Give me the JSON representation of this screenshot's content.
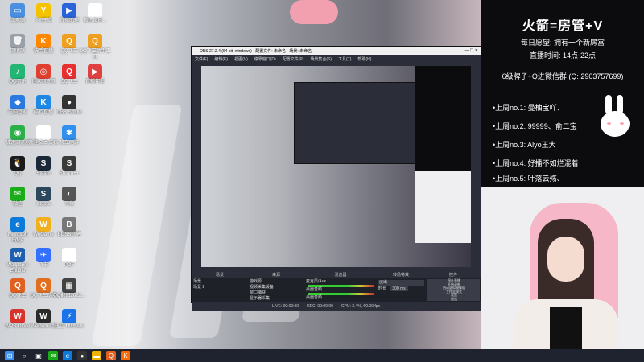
{
  "desktop": {
    "icons": [
      {
        "label": "此电脑",
        "color": "#4a8fe0",
        "glyph": "▭"
      },
      {
        "label": "YY开播",
        "color": "#f5c200",
        "glyph": "Y"
      },
      {
        "label": "直播助理",
        "color": "#2a64d8",
        "glyph": "▶"
      },
      {
        "label": "微信图片...",
        "color": "#ffffff",
        "glyph": "▦"
      },
      {
        "label": "回收站",
        "color": "#9aa0a8",
        "glyph": "🗑"
      },
      {
        "label": "快手直播",
        "color": "#ff8800",
        "glyph": "K"
      },
      {
        "label": "QQ飞车",
        "color": "#f0a020",
        "glyph": "Q"
      },
      {
        "label": "QQ飞车助手工具",
        "color": "#f0a020",
        "glyph": "Q"
      },
      {
        "label": "QQ音乐",
        "color": "#22b573",
        "glyph": "♪"
      },
      {
        "label": "谷歌浏览器",
        "color": "#e04030",
        "glyph": "◎"
      },
      {
        "label": "QQ飞车",
        "color": "#e83030",
        "glyph": "Q"
      },
      {
        "label": "直播伴侣",
        "color": "#e04040",
        "glyph": "▶"
      },
      {
        "label": "电脑管家",
        "color": "#2a7ae0",
        "glyph": "◆"
      },
      {
        "label": "酷狗直播",
        "color": "#1f88e5",
        "glyph": "K"
      },
      {
        "label": "OBS Studio",
        "color": "#333333",
        "glyph": "●"
      },
      {
        "label": "",
        "color": "#00000000",
        "glyph": ""
      },
      {
        "label": "极速浏览器",
        "color": "#2bb04a",
        "glyph": "◉"
      },
      {
        "label": "新建文本文档",
        "color": "#ffffff",
        "glyph": "▤"
      },
      {
        "label": "风车网游",
        "color": "#3090f0",
        "glyph": "✱"
      },
      {
        "label": "",
        "color": "#00000000",
        "glyph": ""
      },
      {
        "label": "QQ",
        "color": "#1a1a1a",
        "glyph": "🐧"
      },
      {
        "label": "Steam",
        "color": "#1b2838",
        "glyph": "S"
      },
      {
        "label": "Steam++",
        "color": "#3a3a3a",
        "glyph": "S"
      },
      {
        "label": "",
        "color": "#00000000",
        "glyph": ""
      },
      {
        "label": "微信",
        "color": "#1aad19",
        "glyph": "✉"
      },
      {
        "label": "Steam",
        "color": "#2a475e",
        "glyph": "S"
      },
      {
        "label": "斗鱼",
        "color": "#555555",
        "glyph": "◐"
      },
      {
        "label": "",
        "color": "#00000000",
        "glyph": ""
      },
      {
        "label": "Microsoft Edge",
        "color": "#0c7ad8",
        "glyph": "e"
      },
      {
        "label": "WeGame",
        "color": "#f0b020",
        "glyph": "W"
      },
      {
        "label": "BOSS直聘",
        "color": "#777777",
        "glyph": "B"
      },
      {
        "label": "",
        "color": "#00000000",
        "glyph": ""
      },
      {
        "label": "Wallpaper Engine",
        "color": "#1e5fb0",
        "glyph": "W"
      },
      {
        "label": "飞书",
        "color": "#3370ff",
        "glyph": "✈"
      },
      {
        "label": "PDF",
        "color": "#ffffff",
        "glyph": "P"
      },
      {
        "label": "",
        "color": "#00000000",
        "glyph": ""
      },
      {
        "label": "QQ飞车",
        "color": "#e06020",
        "glyph": "Q"
      },
      {
        "label": "QQ飞车助手",
        "color": "#e07020",
        "glyph": "Q"
      },
      {
        "label": "QQ截图2022...",
        "color": "#444444",
        "glyph": "▦"
      },
      {
        "label": "",
        "color": "#00000000",
        "glyph": ""
      },
      {
        "label": "WPS Office",
        "color": "#d9342b",
        "glyph": "W"
      },
      {
        "label": "WeGame版",
        "color": "#2a2a2a",
        "glyph": "W"
      },
      {
        "label": "迅雷 Ultimate",
        "color": "#1a73e8",
        "glyph": "⚡"
      }
    ]
  },
  "obs": {
    "title": "OBS 27.2.4 (64 bit, windows) - 配置文件: 未命名 - 场景: 未命名",
    "menu": [
      "文件(F)",
      "编辑(E)",
      "视图(V)",
      "停靠窗口(D)",
      "配置文件(P)",
      "场景集合(S)",
      "工具(T)",
      "帮助(H)"
    ],
    "docks": {
      "scenes_header": "场景",
      "sources_header": "来源",
      "mixer_header": "混音器",
      "transitions_header": "转场特效",
      "controls_header": "控件",
      "scenes": [
        "场景",
        "场景 2"
      ],
      "sources": [
        "游戏源",
        "视频采集设备",
        "窗口捕获",
        "显示器采集"
      ],
      "mixer": [
        "麦克风/Aux",
        "桌面音频",
        "桌面音频"
      ],
      "transition_name": "淡出",
      "duration_label": "时长",
      "duration_value": "300 ms",
      "controls": [
        "停止直播",
        "开始录制",
        "启动虚拟摄像机",
        "工作室模式",
        "设置",
        "退出"
      ]
    },
    "status": [
      "LIVE: 00:00:00",
      "REC: 00:00:00",
      "CPU: 3.4%, 60.00 fps"
    ]
  },
  "overlay": {
    "title": "火箭=房管+V",
    "wish": "每日愿望: 拥有一个新房宫",
    "live_time": "直播时间: 14点-22点",
    "group": "6级牌子+Q进微信群 (Q: 2903757699)",
    "ranks": [
      "•上周no.1: 曼柚宝吖、",
      "•上周no.2: 99999、俞二宝",
      "•上周no.3: Alyo王大",
      "•上周no.4: 好播不如烂混着",
      "•上周no.5: 叶落云殇、"
    ]
  },
  "taskbar": {
    "items": [
      {
        "name": "start",
        "glyph": "⊞",
        "color": "#3a8ff0"
      },
      {
        "name": "search",
        "glyph": "○",
        "color": "#ffffff00"
      },
      {
        "name": "taskview",
        "glyph": "▣",
        "color": "#ffffff00"
      },
      {
        "name": "wechat",
        "glyph": "✉",
        "color": "#1aad19"
      },
      {
        "name": "edge",
        "glyph": "e",
        "color": "#0c7ad8"
      },
      {
        "name": "obs",
        "glyph": "●",
        "color": "#333333"
      },
      {
        "name": "explorer",
        "glyph": "▬",
        "color": "#f0b400"
      },
      {
        "name": "qqspeed",
        "glyph": "Q",
        "color": "#e06020"
      },
      {
        "name": "kuaishou",
        "glyph": "K",
        "color": "#ff6a00"
      }
    ]
  },
  "colors": {
    "accent": "#1f88e5",
    "overlay_bg": "#0c0c0f",
    "obs_bg": "#2b2e38"
  }
}
